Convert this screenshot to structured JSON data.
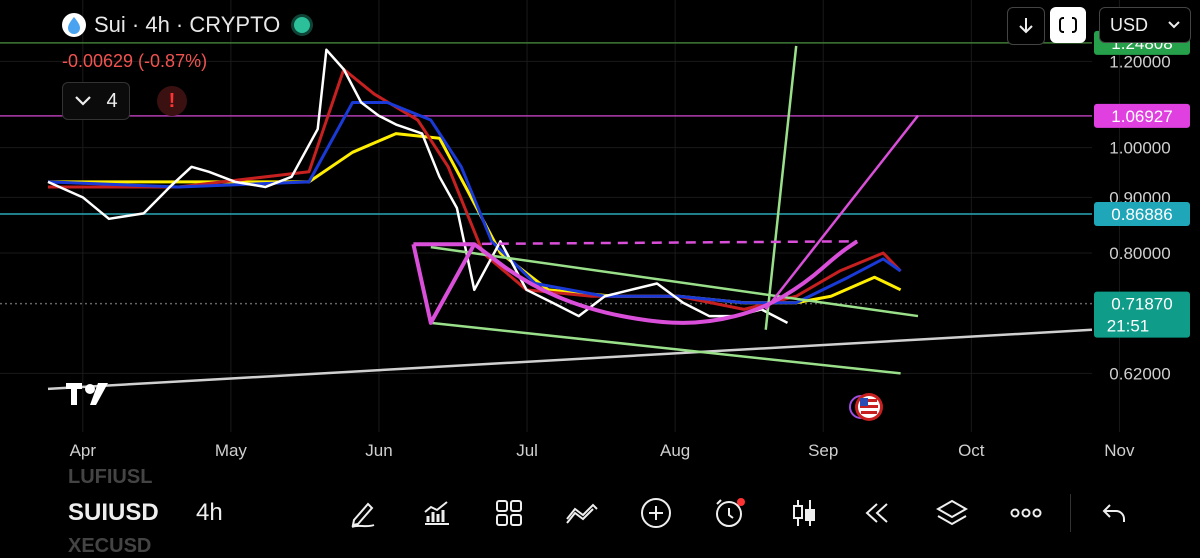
{
  "header": {
    "title": "Sui · 4h · CRYPTO",
    "change": "-0.00629 (-0.87%)",
    "indicator_count": "4"
  },
  "toolbar_top": {
    "currency": "USD"
  },
  "chart_data": {
    "type": "line",
    "symbol": "SUIUSD",
    "timeframe": "4h",
    "x_tick_labels": [
      "Apr",
      "May",
      "Jun",
      "Jul",
      "Aug",
      "Sep",
      "Oct",
      "Nov"
    ],
    "y_tick_labels": [
      "1.20000",
      "1.00000",
      "0.90000",
      "0.80000",
      "0.62000"
    ],
    "y_ticks": [
      1.2,
      1.0,
      0.9,
      0.8,
      0.62
    ],
    "ylim": [
      0.55,
      1.31
    ],
    "scale": "log",
    "price_labels": [
      {
        "text": "1.24808",
        "value": 1.24808,
        "color": "#26a04a",
        "text_color": "#ffffff"
      },
      {
        "text": "1.06927",
        "value": 1.06927,
        "color": "#e040e0",
        "text_color": "#ffffff"
      },
      {
        "text": "0.86886",
        "value": 0.86886,
        "color": "#1fa6b8",
        "text_color": "#ffffff"
      },
      {
        "text": "0.71870",
        "value": 0.7187,
        "color": "#0f9d8a",
        "text_color": "#ffffff"
      }
    ],
    "countdown": "21:51",
    "horizontal_lines": [
      {
        "value": 1.24808,
        "color": "#3f7a35"
      },
      {
        "value": 1.06927,
        "color": "#b13cb1"
      },
      {
        "value": 0.86886,
        "color": "#2aa7b8"
      },
      {
        "value": 0.7187,
        "color": "#666666",
        "dashed": true
      }
    ],
    "price_series": {
      "name": "",
      "color": "#ffffff",
      "x": [
        0,
        8,
        14,
        22,
        28,
        33,
        37,
        43,
        50,
        56,
        62,
        64,
        68,
        72,
        76,
        80,
        86,
        90,
        94,
        98,
        104,
        110,
        116,
        122,
        128,
        134,
        140,
        146,
        152,
        158,
        164,
        170
      ],
      "y": [
        0.93,
        0.9,
        0.86,
        0.87,
        0.92,
        0.96,
        0.95,
        0.93,
        0.92,
        0.94,
        1.04,
        1.23,
        1.18,
        1.1,
        1.07,
        1.05,
        1.03,
        0.94,
        0.88,
        0.74,
        0.82,
        0.74,
        0.72,
        0.7,
        0.73,
        0.74,
        0.75,
        0.72,
        0.7,
        0.7,
        0.71,
        0.69
      ]
    },
    "series": [
      {
        "color": "#ffee00",
        "x": [
          0,
          30,
          60,
          70,
          80,
          90,
          96,
          104,
          115,
          130,
          145,
          160,
          172,
          180,
          190,
          196
        ],
        "y": [
          0.93,
          0.93,
          0.93,
          0.99,
          1.03,
          1.02,
          0.92,
          0.8,
          0.74,
          0.73,
          0.73,
          0.72,
          0.72,
          0.73,
          0.76,
          0.74
        ]
      },
      {
        "color": "#c62020",
        "x": [
          0,
          30,
          60,
          68,
          75,
          85,
          92,
          100,
          110,
          125,
          145,
          160,
          172,
          182,
          192,
          196
        ],
        "y": [
          0.92,
          0.92,
          0.95,
          1.18,
          1.12,
          1.06,
          0.96,
          0.8,
          0.74,
          0.73,
          0.73,
          0.71,
          0.73,
          0.77,
          0.8,
          0.77
        ]
      },
      {
        "color": "#1a3ad8",
        "x": [
          0,
          30,
          60,
          70,
          78,
          88,
          95,
          102,
          112,
          128,
          145,
          160,
          172,
          184,
          192,
          196
        ],
        "y": [
          0.93,
          0.92,
          0.93,
          1.1,
          1.1,
          1.06,
          0.96,
          0.82,
          0.75,
          0.73,
          0.73,
          0.72,
          0.72,
          0.76,
          0.79,
          0.77
        ]
      }
    ],
    "drawings": [
      {
        "kind": "trendline",
        "color": "#d0d0d0",
        "from": [
          0,
          0.6
        ],
        "to": [
          240,
          0.68
        ]
      },
      {
        "kind": "trendline",
        "color": "#9ae08a",
        "from": [
          88,
          0.81
        ],
        "to": [
          200,
          0.7
        ]
      },
      {
        "kind": "trendline",
        "color": "#9ae08a",
        "from": [
          88,
          0.69
        ],
        "to": [
          196,
          0.62
        ]
      },
      {
        "kind": "trendline",
        "color": "#9ae08a",
        "from": [
          165,
          0.68
        ],
        "to": [
          172,
          1.24
        ]
      },
      {
        "kind": "trendline",
        "color": "#d94fd9",
        "from": [
          165,
          0.71
        ],
        "to": [
          200,
          1.07
        ]
      },
      {
        "kind": "dashed",
        "color": "#d94fd9",
        "from": [
          88,
          0.815
        ],
        "to": [
          186,
          0.82
        ]
      },
      {
        "kind": "polyline",
        "color": "#d94fd9",
        "points": [
          [
            84,
            0.815
          ],
          [
            88,
            0.69
          ],
          [
            98,
            0.815
          ],
          [
            84,
            0.815
          ]
        ]
      },
      {
        "kind": "arc",
        "color": "#d94fd9",
        "points": [
          [
            98,
            0.815
          ],
          [
            110,
            0.75
          ],
          [
            124,
            0.71
          ],
          [
            140,
            0.69
          ],
          [
            152,
            0.69
          ],
          [
            164,
            0.71
          ],
          [
            174,
            0.75
          ],
          [
            182,
            0.8
          ],
          [
            186,
            0.82
          ]
        ]
      }
    ],
    "grid": true,
    "legend": "none"
  },
  "bottom_bar": {
    "symbol": "SUIUSD",
    "timeframe": "4h",
    "ghost_above": "LUFIUSL",
    "ghost_below": "XECUSD"
  },
  "colors": {
    "background": "#000000",
    "accent": "#2bbf9a",
    "negative": "#f05350"
  }
}
